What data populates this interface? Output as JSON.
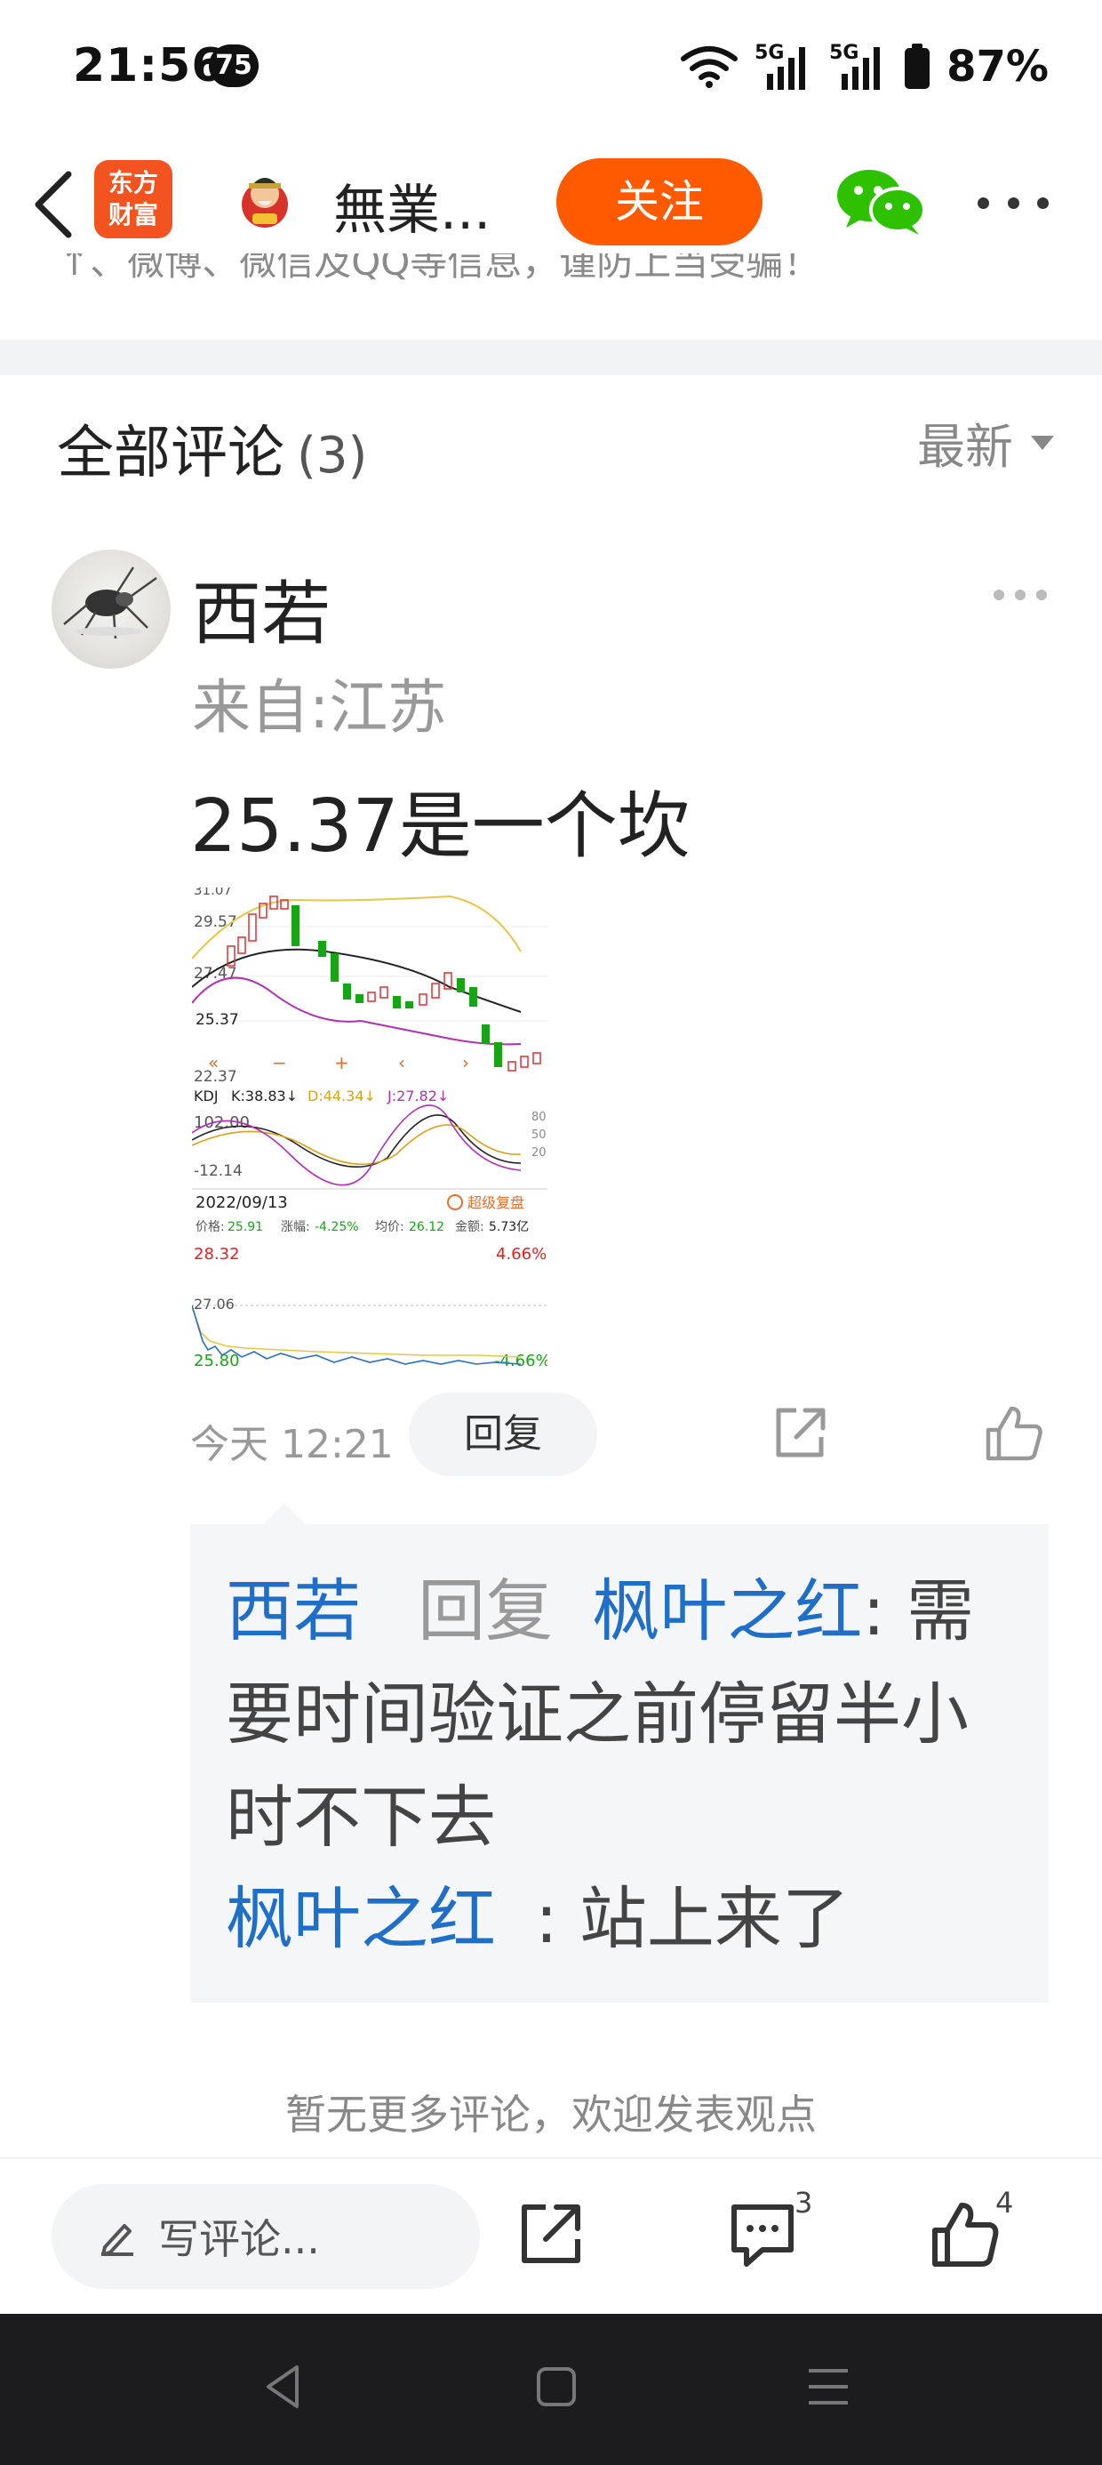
{
  "status_bar": {
    "time": "21:56",
    "notification_count": "75",
    "network": "5G",
    "battery": "87%"
  },
  "header": {
    "app_logo_text": "东方财富",
    "author_name": "無業...",
    "follow_label": "关注"
  },
  "article_clipped_text": "↑、微博、微信及QQ等信息，谨防上当受骗！",
  "comments": {
    "title": "全部评论",
    "count": "(3)",
    "sort_label": "最新",
    "items": [
      {
        "name": "西若",
        "location": "来自:江苏",
        "text": "25.37是一个坎",
        "time": "今天 12:21",
        "reply_label": "回复",
        "replies": [
          {
            "from": "西若",
            "verb": "回复",
            "to": "枫叶之红",
            "text": ": 需要时间验证之前停留半小时不下去"
          },
          {
            "from": "枫叶之红",
            "text": ": 站上来了"
          }
        ]
      }
    ]
  },
  "chart_image": {
    "top_label": "31.07",
    "y_labels": [
      "29.57",
      "27.47",
      "25.37",
      "22.37"
    ],
    "kdj_label": "KDJ",
    "kdj_k": "K:38.83↓",
    "kdj_d": "D:44.34↓",
    "kdj_j": "J:27.82↓",
    "kdj_top": "102.00",
    "kdj_bottom": "-12.14",
    "kdj_right": [
      "80",
      "50",
      "20"
    ],
    "date": "2022/09/13",
    "replay_label": "超级复盘",
    "price_label": "价格:",
    "price_value": "25.91",
    "change_label": "涨幅:",
    "change_value": "-4.25%",
    "avg_label": "均价:",
    "avg_value": "26.12",
    "amount_label": "金额:",
    "amount_value": "5.73亿",
    "intraday_high": "28.32",
    "intraday_high_pct": "4.66%",
    "intraday_mid": "27.06",
    "intraday_low": "25.80",
    "intraday_low_pct": "-4.66%"
  },
  "footer_text": "暂无更多评论，欢迎发表观点",
  "bottom_bar": {
    "write_placeholder": "写评论...",
    "comment_count": "3",
    "like_count": "4"
  },
  "colors": {
    "accent": "#ff5a00",
    "link_blue": "#1f6fc8",
    "logo": "#f3531f"
  }
}
